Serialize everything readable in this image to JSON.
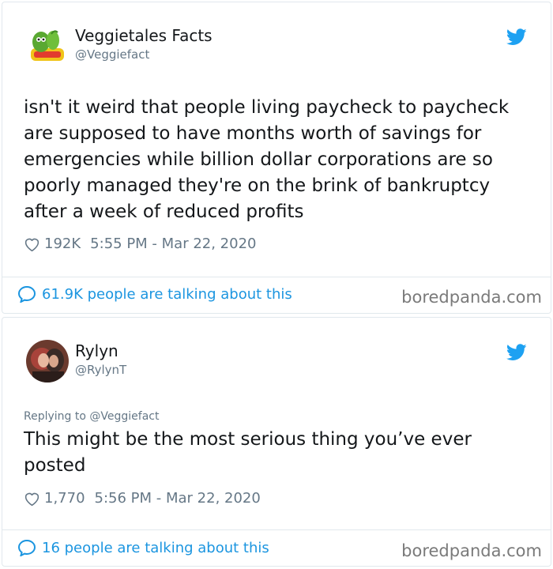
{
  "tweets": [
    {
      "display_name": "Veggietales Facts",
      "handle": "@Veggiefact",
      "avatar_icon": "veggietales-logo-avatar",
      "text": "isn't it weird that people living paycheck to paycheck are supposed to have months worth of savings for emergencies while billion dollar corporations are so poorly managed they're on the brink of bankruptcy after a week of reduced profits",
      "likes": "192K",
      "timestamp": "5:55 PM - Mar 22, 2020",
      "talking": "61.9K people are talking about this"
    },
    {
      "display_name": "Rylyn",
      "handle": "@RylynT",
      "avatar_icon": "profile-photo-avatar",
      "replying_label": "Replying to",
      "replying_to": "@Veggiefact",
      "text": "This might be the most serious thing you’ve ever posted",
      "likes": "1,770",
      "timestamp": "5:56 PM - Mar 22, 2020",
      "talking": "16 people are talking about this"
    }
  ],
  "watermark": "boredpanda.com",
  "colors": {
    "twitter_blue": "#1da1f2",
    "link_blue": "#1b95e0",
    "secondary_text": "#657786",
    "primary_text": "#14171a",
    "border": "#e1e8ed"
  }
}
